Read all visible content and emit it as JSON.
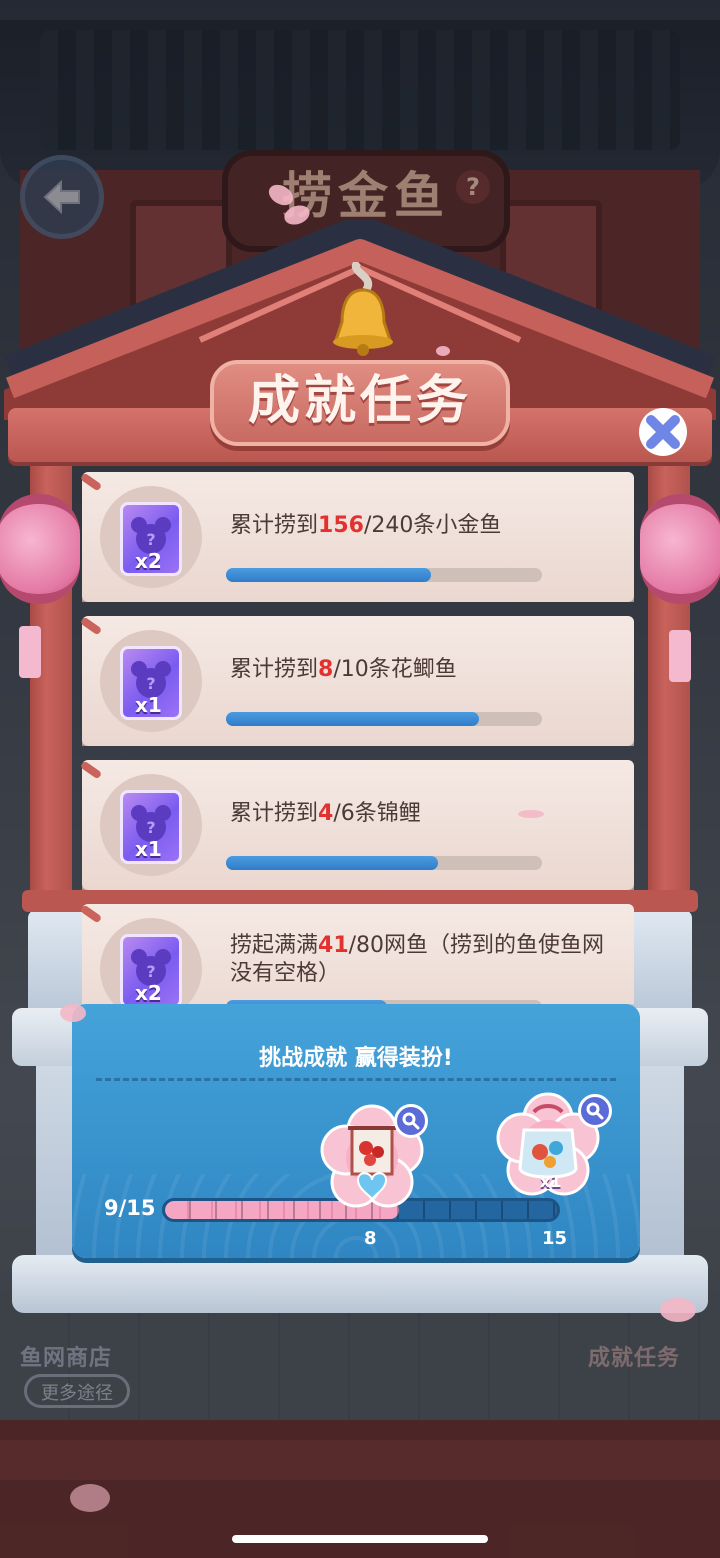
{
  "background": {
    "sign_text": "捞金鱼",
    "sign_help": "?",
    "shop_label": "鱼网商店",
    "more_ways": "更多途径",
    "achievements_label": "成就任务"
  },
  "dialog": {
    "title": "成就任务",
    "close_icon": "close-x-icon"
  },
  "tasks": [
    {
      "prefix": "累计捞到",
      "current": "156",
      "rest": "/240条小金鱼",
      "progress": 0.65,
      "reward_qty": "x2",
      "reward_icon": "mystery-bear-ticket-icon"
    },
    {
      "prefix": "累计捞到",
      "current": "8",
      "rest": "/10条花鲫鱼",
      "progress": 0.8,
      "reward_qty": "x1",
      "reward_icon": "mystery-bear-ticket-icon"
    },
    {
      "prefix": "累计捞到",
      "current": "4",
      "rest": "/6条锦鲤",
      "progress": 0.67,
      "reward_qty": "x1",
      "reward_icon": "mystery-bear-ticket-icon"
    },
    {
      "prefix": "捞起满满",
      "current": "41",
      "rest": "/80网鱼（捞到的鱼使鱼网没有空格）",
      "progress": 0.51,
      "reward_qty": "x2",
      "reward_icon": "mystery-bear-ticket-icon"
    }
  ],
  "challenge": {
    "title": "挑战成就 赢得装扮!",
    "progress_text": "9/15",
    "progress_value": 9,
    "progress_max": 15,
    "milestones": [
      {
        "value": "8",
        "reward": "koi-fan-decoration",
        "qty": ""
      },
      {
        "value": "15",
        "reward": "fish-bag",
        "qty": "x1"
      }
    ]
  },
  "colors": {
    "accent_red": "#e1322f",
    "task_bar": "#2f7dc9",
    "panel_blue": "#3a95d0",
    "progress_pink": "#f4a6c3"
  }
}
